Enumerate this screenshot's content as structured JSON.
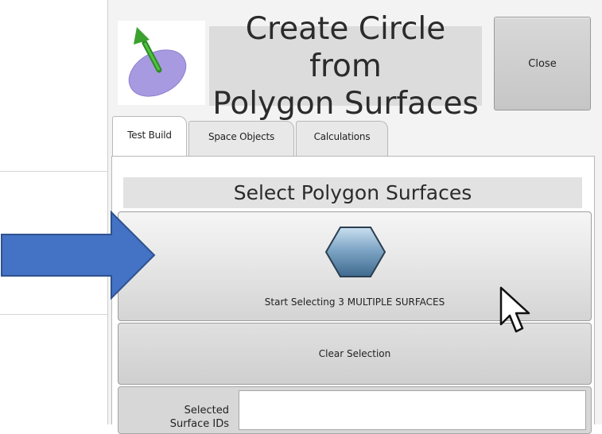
{
  "dialog": {
    "title_line1": "Create Circle from",
    "title_line2": "Polygon Surfaces",
    "close_label": "Close",
    "icon": "circle-from-polygon-icon"
  },
  "tabs": [
    {
      "label": "Test Build",
      "active": true
    },
    {
      "label": "Space Objects",
      "active": false
    },
    {
      "label": "Calculations",
      "active": false
    }
  ],
  "section": {
    "heading": "Select Polygon Surfaces",
    "start_button_label": "Start Selecting 3  MULTIPLE SURFACES",
    "start_button_icon": "hexagon-icon",
    "clear_button_label": "Clear Selection",
    "selected_label_line1": "Selected",
    "selected_label_line2": "Surface IDs",
    "selected_value": ""
  },
  "overlays": {
    "arrow": "right-arrow-annotation",
    "arrow_color": "#4472c4",
    "cursor": "mouse-pointer-icon"
  },
  "colors": {
    "panel_bg": "#f3f3f3",
    "title_bg": "#dcdcdc",
    "ellipse_fill": "#a89ae0",
    "arrow_green": "#3aa12f"
  }
}
